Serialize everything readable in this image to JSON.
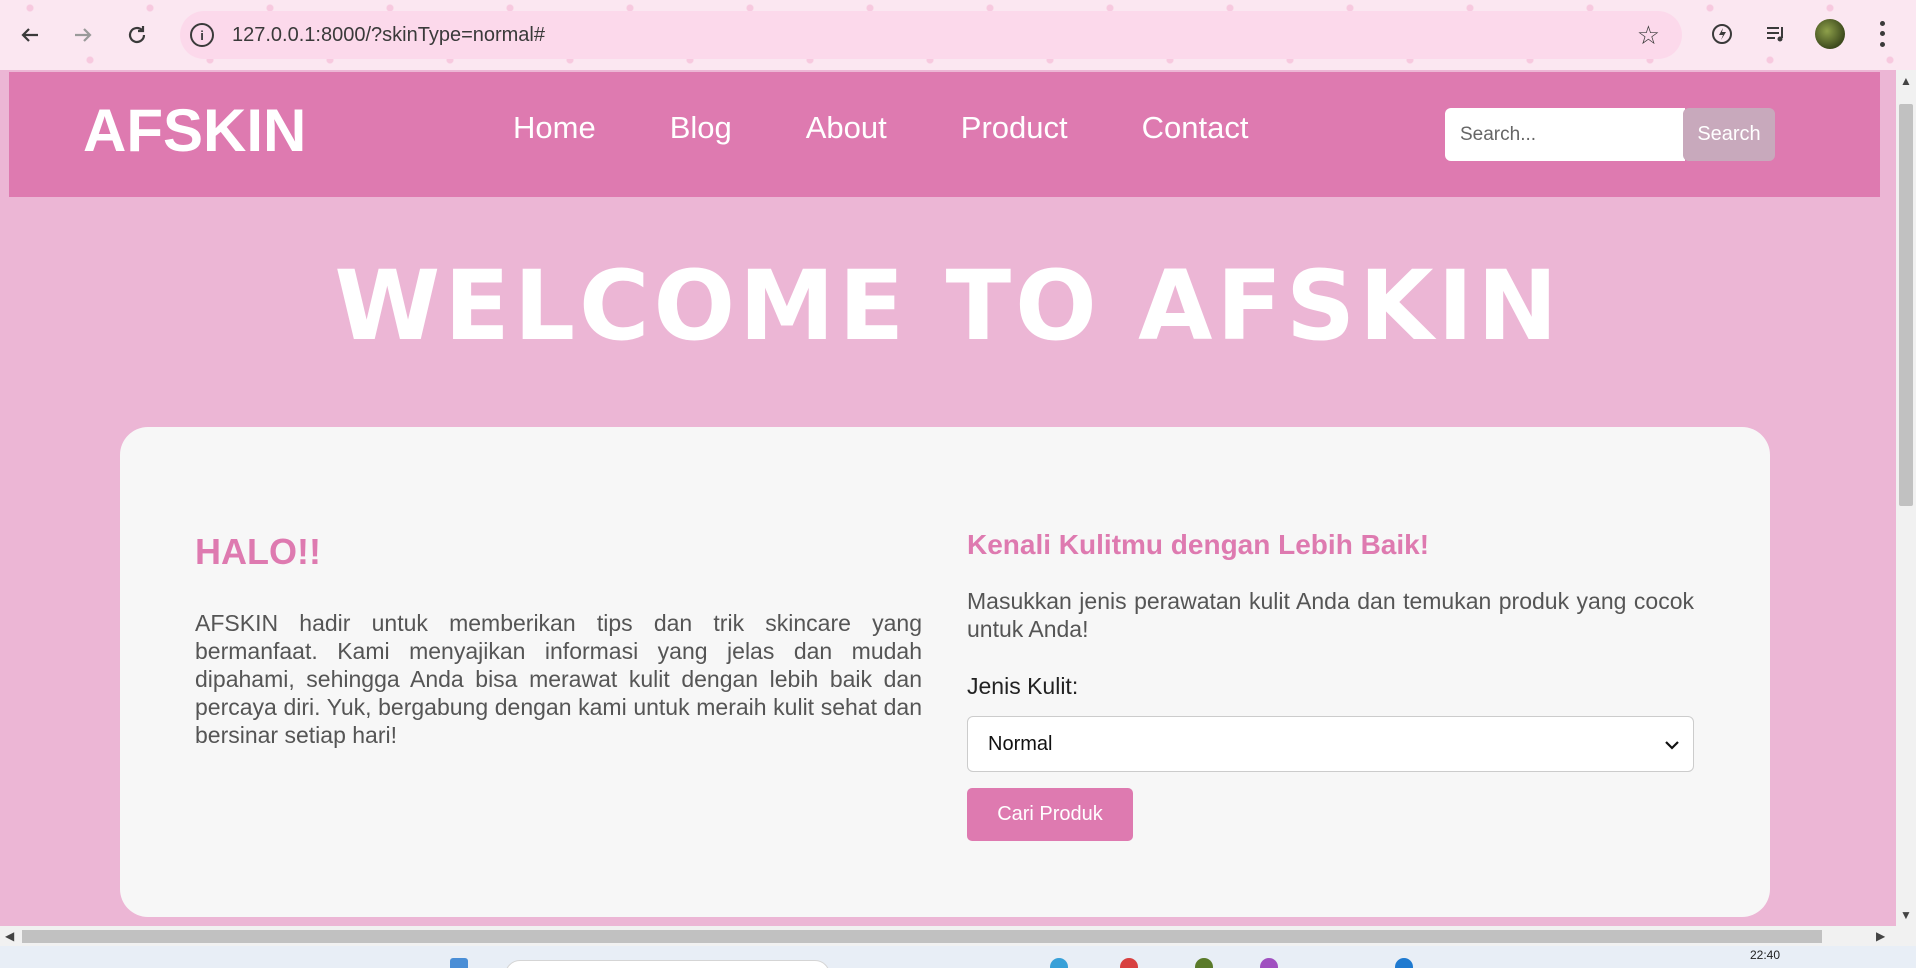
{
  "browser": {
    "url": "127.0.0.1:8000/?skinType=normal#"
  },
  "site": {
    "logo": "AFSKIN",
    "nav": [
      "Home",
      "Blog",
      "About",
      "Product",
      "Contact"
    ],
    "search": {
      "placeholder": "Search...",
      "button_label": "Search"
    }
  },
  "hero": {
    "title": "WELCOME TO AFSKIN"
  },
  "intro": {
    "heading": "HALO!!",
    "body": "AFSKIN hadir untuk memberikan tips dan trik skincare yang bermanfaat. Kami menyajikan informasi yang jelas dan mudah dipahami, sehingga Anda bisa merawat kulit dengan lebih baik dan percaya diri. Yuk, bergabung dengan kami untuk meraih kulit sehat dan bersinar setiap hari!"
  },
  "skin_form": {
    "heading": "Kenali Kulitmu dengan Lebih Baik!",
    "description": "Masukkan jenis perawatan kulit Anda dan temukan produk yang cocok untuk Anda!",
    "label": "Jenis Kulit:",
    "selected": "Normal",
    "button_label": "Cari Produk"
  },
  "taskbar": {
    "time": "22:40"
  },
  "colors": {
    "header": "#de7ab0",
    "page_bg": "#ecb6d5",
    "card_bg": "#f7f7f7",
    "accent_text": "#de7ab0"
  },
  "icons": [
    "back-arrow-icon",
    "forward-arrow-icon",
    "reload-icon",
    "info-icon",
    "star-icon",
    "extension-icon",
    "media-control-icon",
    "profile-avatar",
    "more-vert-icon"
  ]
}
